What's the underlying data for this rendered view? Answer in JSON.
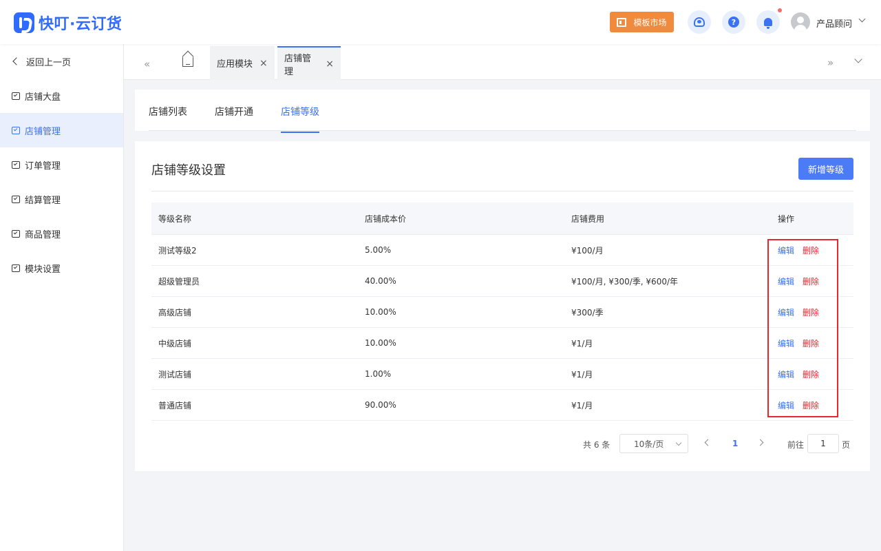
{
  "app": {
    "logo_text": "快叮·云订货"
  },
  "header": {
    "market_label": "模板市场",
    "help_glyph": "?",
    "user_name": "产品顾问",
    "icons": [
      "agent-icon",
      "help-icon",
      "bell-icon",
      "avatar"
    ]
  },
  "sidebar": {
    "back_label": "返回上一页",
    "items": [
      {
        "label": "店铺大盘",
        "active": false
      },
      {
        "label": "店铺管理",
        "active": true
      },
      {
        "label": "订单管理",
        "active": false
      },
      {
        "label": "结算管理",
        "active": false
      },
      {
        "label": "商品管理",
        "active": false
      },
      {
        "label": "模块设置",
        "active": false
      }
    ]
  },
  "tabbar": {
    "dbl_left": "«",
    "dbl_right": "»",
    "tabs": [
      {
        "label": "应用模块",
        "close": "×"
      },
      {
        "label": "店铺管理",
        "close": "×"
      }
    ]
  },
  "subtabs": [
    {
      "label": "店铺列表"
    },
    {
      "label": "店铺开通"
    },
    {
      "label": "店铺等级"
    }
  ],
  "main": {
    "title": "店铺等级设置",
    "add_button": "新增等级",
    "columns": [
      "等级名称",
      "店铺成本价",
      "店铺费用",
      "操作"
    ],
    "rows": [
      {
        "name": "测试等级2",
        "cost": "5.00%",
        "fee": "¥100/月"
      },
      {
        "name": "超级管理员",
        "cost": "40.00%",
        "fee": "¥100/月, ¥300/季, ¥600/年"
      },
      {
        "name": "高级店铺",
        "cost": "10.00%",
        "fee": "¥300/季"
      },
      {
        "name": "中级店铺",
        "cost": "10.00%",
        "fee": "¥1/月"
      },
      {
        "name": "测试店铺",
        "cost": "1.00%",
        "fee": "¥1/月"
      },
      {
        "name": "普通店铺",
        "cost": "90.00%",
        "fee": "¥1/月"
      }
    ],
    "edit_label": "编辑",
    "delete_label": "删除"
  },
  "pagination": {
    "total": "共 6 条",
    "page_size": "10条/页",
    "current_page": "1",
    "goto_label": "前往",
    "goto_value": "1",
    "page_suffix": "页"
  },
  "colors": {
    "accent": "#3b72f5",
    "danger": "#f5222d",
    "market": "#f08a3c",
    "highlight_box": "#e8262d"
  }
}
